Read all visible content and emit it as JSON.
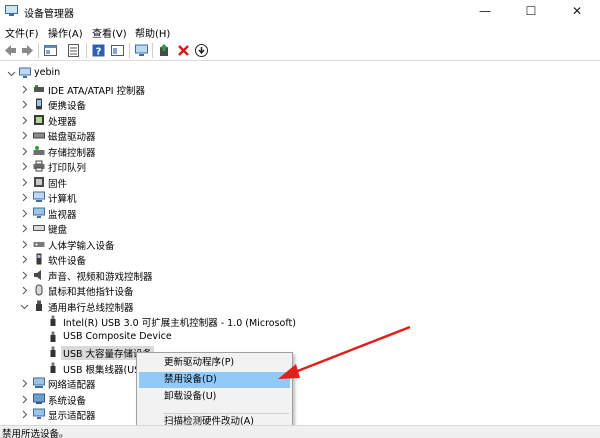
{
  "window": {
    "title": "设备管理器",
    "minimize_glyph": "—",
    "maximize_glyph": "☐",
    "close_glyph": "✕"
  },
  "menu": {
    "items": [
      "文件(F)",
      "操作(A)",
      "查看(V)",
      "帮助(H)"
    ]
  },
  "toolbar": {
    "buttons": [
      "back-icon",
      "forward-icon",
      "properties-icon",
      "list-icon",
      "help-icon",
      "view-icon",
      "monitor-icon",
      "update-driver-icon",
      "uninstall-icon",
      "download-icon"
    ]
  },
  "tree": {
    "root": "yebin",
    "categories": [
      {
        "label": "IDE ATA/ATAPI 控制器",
        "icon": "ide-controller-icon"
      },
      {
        "label": "便携设备",
        "icon": "portable-device-icon"
      },
      {
        "label": "处理器",
        "icon": "processor-icon"
      },
      {
        "label": "磁盘驱动器",
        "icon": "disk-drive-icon"
      },
      {
        "label": "存储控制器",
        "icon": "storage-controller-icon"
      },
      {
        "label": "打印队列",
        "icon": "printer-icon"
      },
      {
        "label": "固件",
        "icon": "firmware-icon"
      },
      {
        "label": "计算机",
        "icon": "computer-icon"
      },
      {
        "label": "监视器",
        "icon": "monitor-icon"
      },
      {
        "label": "键盘",
        "icon": "keyboard-icon"
      },
      {
        "label": "人体学输入设备",
        "icon": "hid-icon"
      },
      {
        "label": "软件设备",
        "icon": "software-device-icon"
      },
      {
        "label": "声音、视频和游戏控制器",
        "icon": "sound-icon"
      },
      {
        "label": "鼠标和其他指针设备",
        "icon": "mouse-icon"
      },
      {
        "label": "通用串行总线控制器",
        "icon": "usb-controller-icon"
      }
    ],
    "usb_children": [
      "Intel(R) USB 3.0 可扩展主机控制器 - 1.0 (Microsoft)",
      "USB Composite Device",
      "USB 大容量存储设备",
      "USB 根集线器(US"
    ],
    "after": [
      {
        "label": "网络适配器",
        "icon": "network-adapter-icon"
      },
      {
        "label": "系统设备",
        "icon": "system-device-icon"
      },
      {
        "label": "显示适配器",
        "icon": "display-adapter-icon"
      }
    ]
  },
  "context_menu": {
    "items": [
      "更新驱动程序(P)",
      "禁用设备(D)",
      "卸载设备(U)",
      "扫描检测硬件改动(A)"
    ],
    "highlighted_index": 1
  },
  "status": {
    "text": "禁用所选设备。"
  }
}
